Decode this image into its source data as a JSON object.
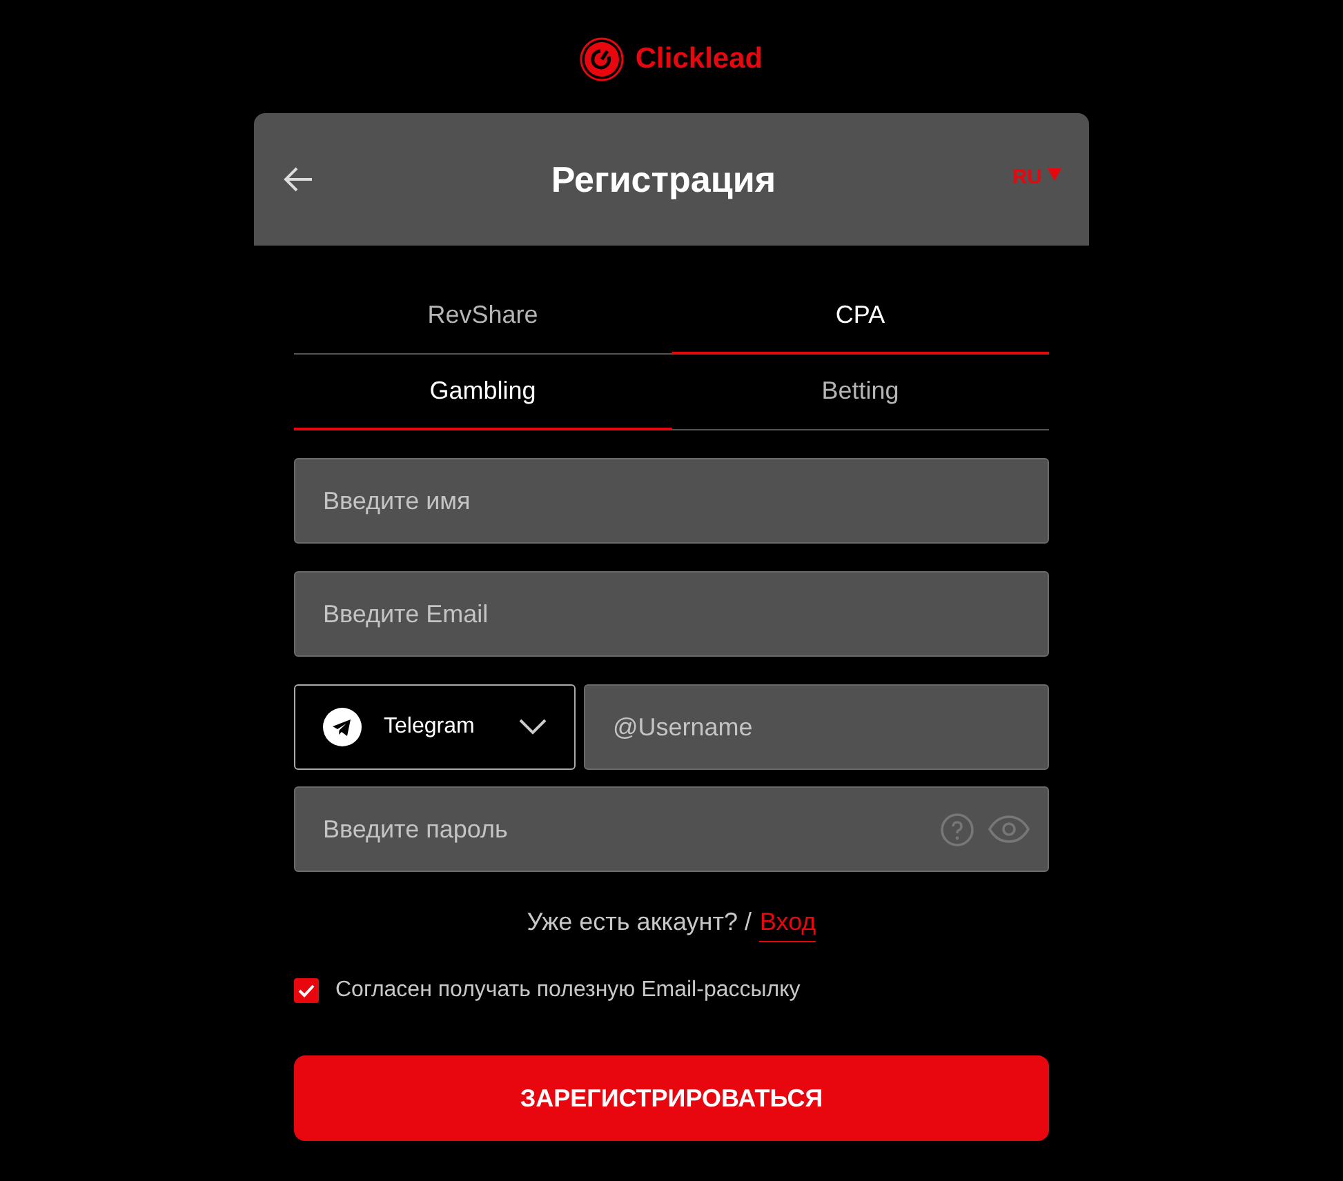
{
  "logo": {
    "text": "Clicklead"
  },
  "header": {
    "title": "Регистрация",
    "language": "RU"
  },
  "tab_rows": [
    [
      {
        "label": "RevShare",
        "selected": false
      },
      {
        "label": "CPA",
        "selected": true
      }
    ],
    [
      {
        "label": "Gambling",
        "selected": true
      },
      {
        "label": "Betting",
        "selected": false
      }
    ]
  ],
  "name_field": {
    "placeholder": "Введите имя"
  },
  "email_field": {
    "placeholder": "Введите Email"
  },
  "messenger": {
    "value": "Telegram"
  },
  "username_field": {
    "placeholder": "@Username"
  },
  "password_field": {
    "placeholder": "Введите пароль"
  },
  "login_prompt": {
    "text": "Уже есть аккаунт? /",
    "link": "Вход"
  },
  "newsletter": {
    "label": "Согласен получать полезную Email-рассылку",
    "checked": true
  },
  "submit": {
    "label": "ЗАРЕГИСТРИРОВАТЬСЯ"
  }
}
